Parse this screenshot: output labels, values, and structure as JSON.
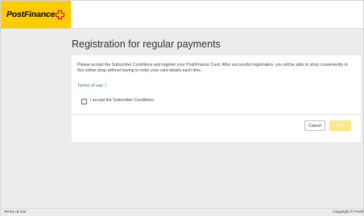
{
  "header": {
    "logo_text": "PostFinance"
  },
  "page": {
    "title": "Registration for regular payments"
  },
  "card": {
    "description": "Please accept the Subscriber Conditions and register your PostFinance Card. After successful registration, you will be able to shop conveniently in this online shop without having to enter your card details each time.",
    "terms_link": "Terms of use",
    "checkbox_label": "I accept the Subscriber Conditions."
  },
  "buttons": {
    "cancel": "Cancel",
    "next": "Next"
  },
  "footer": {
    "terms": "Terms of use",
    "copyright": "Copyright © Postf"
  },
  "colors": {
    "brand_yellow": "#ffcc00",
    "brand_red": "#e4002b",
    "link_blue": "#2a6aa8",
    "next_disabled": "#fbe68a"
  },
  "icons": {
    "logo_mark": "postfinance-cross-icon",
    "terms_chevron": "chevron-right-icon"
  }
}
